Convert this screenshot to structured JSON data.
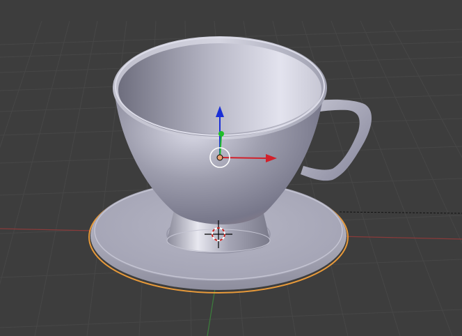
{
  "viewport": {
    "background_color": "#3d3d3d",
    "grid_color": "#474747",
    "x_axis_color": "#8a3a3a",
    "y_axis_color": "#3c7a3c"
  },
  "scene": {
    "objects": [
      {
        "name": "cup",
        "material_color": "#9c9cab",
        "selected": false
      },
      {
        "name": "saucer",
        "material_color": "#a7a7b7",
        "selected": true,
        "outline_color": "#e89a3a"
      }
    ]
  },
  "manipulator": {
    "z_arrow_color": "#1a2fd6",
    "y_handle_color": "#1fbe2a",
    "x_arrow_color": "#d2202a",
    "origin_color": "#e8a070"
  },
  "cursor_3d": {
    "icon": "crosshair-cursor-icon",
    "ring_colors": [
      "#c82020",
      "#ffffff"
    ]
  },
  "relationship_line": {
    "style": "dashed",
    "color": "#111111"
  }
}
